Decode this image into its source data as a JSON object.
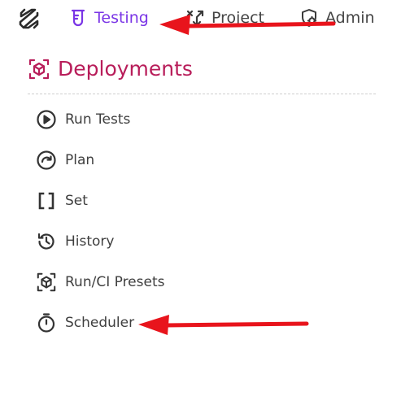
{
  "topnav": {
    "logo_icon": "slash-pencil-logo-icon",
    "items": [
      {
        "label": "Testing",
        "icon": "test-tube-icon",
        "active": true,
        "color": "#7a35e6"
      },
      {
        "label": "Project",
        "icon": "shuffle-icon",
        "active": false
      },
      {
        "label": "Admin",
        "icon": "shield-gear-icon",
        "active": false
      }
    ]
  },
  "section": {
    "title": "Deployments",
    "icon": "cube-scan-icon",
    "color": "#b81d5a"
  },
  "menu": {
    "items": [
      {
        "label": "Run Tests",
        "icon": "play-circle-icon"
      },
      {
        "label": "Plan",
        "icon": "redo-circle-icon"
      },
      {
        "label": "Set",
        "icon": "brackets-icon"
      },
      {
        "label": "History",
        "icon": "history-icon"
      },
      {
        "label": "Run/CI Presets",
        "icon": "cube-scan-icon"
      },
      {
        "label": "Scheduler",
        "icon": "stopwatch-icon"
      }
    ]
  },
  "annotations": {
    "arrow_color": "#e8141c",
    "arrows": [
      "arrow-to-testing-tab",
      "arrow-to-scheduler-item"
    ]
  }
}
